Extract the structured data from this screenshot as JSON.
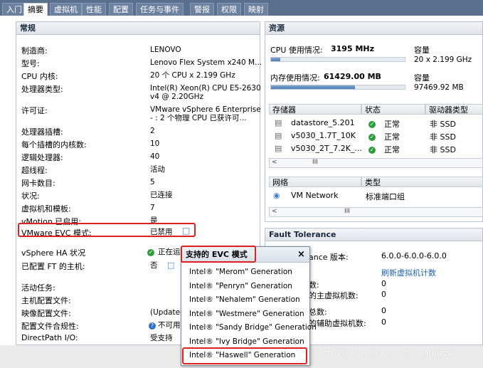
{
  "tabs": [
    "入门",
    "摘要",
    "虚拟机",
    "性能",
    "配置",
    "任务与事件",
    "警报",
    "权限",
    "映射"
  ],
  "general": {
    "title": "常规",
    "rows": [
      {
        "label": "制造商:",
        "value": "LENOVO"
      },
      {
        "label": "型号:",
        "value": "Lenovo Flex System x240 M..."
      },
      {
        "label": "CPU 内核:",
        "value": "20 个 CPU x 2.199 GHz"
      },
      {
        "label": "处理器类型:",
        "value": "Intel(R) Xeon(R) CPU E5-2630",
        "value2": "v4 @ 2.20GHz"
      },
      {
        "label": "许可证:",
        "value": "VMware vSphere 6 Enterprise",
        "value2": "- : 2 个物理 CPU 已获许可..."
      },
      {
        "label": "处理器插槽:",
        "value": "2"
      },
      {
        "label": "每个插槽的内核数:",
        "value": "10"
      },
      {
        "label": "逻辑处理器:",
        "value": "40"
      },
      {
        "label": "超线程:",
        "value": "活动"
      },
      {
        "label": "网卡数目:",
        "value": "5"
      },
      {
        "label": "状况:",
        "value": "已连接"
      },
      {
        "label": "虚拟机和模板:",
        "value": "7"
      },
      {
        "label": "vMotion 已启用:",
        "value": "是"
      },
      {
        "label": "VMware EVC 模式:",
        "value": "已禁用"
      },
      {
        "label": "vSphere HA 状况",
        "value": "正在运"
      },
      {
        "label": "已配置 FT 的主机:",
        "value": "否"
      },
      {
        "label": "活动任务:",
        "value": ""
      },
      {
        "label": "主机配置文件:",
        "value": ""
      },
      {
        "label": "映像配置文件:",
        "value": "(Updated)"
      },
      {
        "label": "配置文件合规性:",
        "value": "不可用"
      },
      {
        "label": "DirectPath I/O:",
        "value": "受支持"
      }
    ]
  },
  "resources": {
    "title": "资源",
    "cpu_label": "CPU 使用情况:",
    "cpu_value": "3195 MHz",
    "cpu_usage_fraction": 0.07,
    "cap_label": "容量",
    "cpu_capacity": "20 x 2.199 GHz",
    "mem_label": "内存使用情况:",
    "mem_value": "61429.00 MB",
    "mem_usage_fraction": 0.63,
    "mem_capacity": "97469.92 MB",
    "storage_headers": [
      "存储器",
      "状态",
      "驱动器类型"
    ],
    "storage": [
      {
        "name": "datastore_5.201",
        "status": "正常",
        "type": "非 SSD"
      },
      {
        "name": "v5030_1.7T_10K",
        "status": "正常",
        "type": "非 SSD"
      },
      {
        "name": "v5030_2T_7.2K_...",
        "status": "正常",
        "type": "非 SSD"
      }
    ],
    "network_headers": [
      "网络",
      "类型"
    ],
    "network": [
      {
        "name": "VM Network",
        "type": "标准端口组"
      }
    ],
    "scroll_glyph": "III"
  },
  "ft": {
    "title": "Fault Tolerance",
    "version_label": "ance 版本:",
    "version_value": "6.0.0-6.0.0-6.0.0",
    "refresh_link": "刷新虚拟机计数",
    "r1_label": "数:",
    "r1_value": "0",
    "r2_label": "的主虚拟机数:",
    "r2_value": "0",
    "r3_label": "总数:",
    "r3_value": "0",
    "r4_label": "的辅助虚拟机数:",
    "r4_value": "0"
  },
  "popup": {
    "title": "支持的 EVC 模式",
    "close": "×",
    "items": [
      "Intel® \"Merom\" Generation",
      "Intel® \"Penryn\" Generation",
      "Intel® \"Nehalem\" Generation",
      "Intel® \"Westmere\" Generation",
      "Intel® \"Sandy Bridge\" Generation",
      "Intel® \"Ivy Bridge\" Generation",
      "Intel® \"Haswell\" Generation"
    ]
  },
  "watermark": "https://blog.csdn.net/longfeizzu",
  "colors": {
    "highlight": "#e02020",
    "tabbar": "#5a6f8c"
  }
}
